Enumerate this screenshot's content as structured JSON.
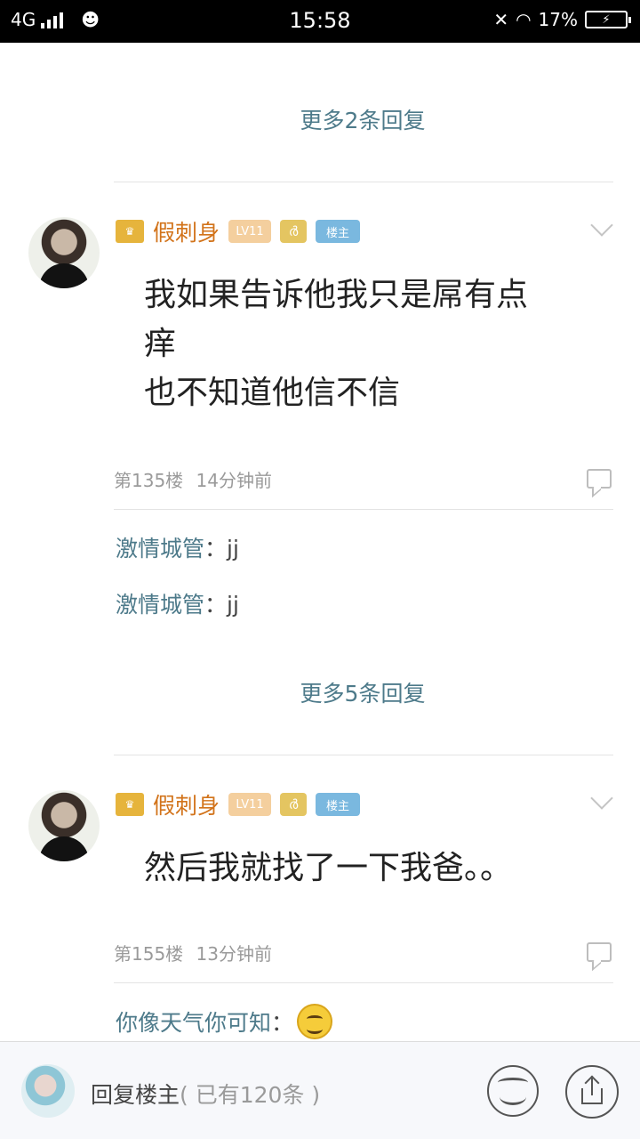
{
  "status_bar": {
    "network": "4G",
    "time": "15:58",
    "battery": "17%"
  },
  "thread": {
    "more_replies_top": "更多2条回复",
    "posts": [
      {
        "username": "假刺身",
        "level_badge": "LV11",
        "sign_badge": "ർ",
        "op_badge": "楼主",
        "text_lines": [
          "我如果告诉他我只是屌有点",
          "痒",
          "也不知道他信不信"
        ],
        "floor": "第135楼",
        "time_ago": "14分钟前",
        "replies": [
          {
            "user": "激情城管",
            "content": "：jj"
          },
          {
            "user": "激情城管",
            "content": "：jj"
          }
        ],
        "more_replies": "更多5条回复"
      },
      {
        "username": "假刺身",
        "level_badge": "LV11",
        "sign_badge": "ർ",
        "op_badge": "楼主",
        "text_lines": [
          "然后我就找了一下我爸。。"
        ],
        "floor": "第155楼",
        "time_ago": "13分钟前",
        "replies": [
          {
            "user": "你像天气你可知",
            "content": "："
          }
        ]
      }
    ]
  },
  "bottom_bar": {
    "reply_label": "回复楼主",
    "reply_count": "( 已有120条 )"
  },
  "icons": {
    "crown": "crown-icon",
    "chevron": "chevron-down-icon",
    "comment": "comment-icon",
    "emoji": "emoji-icon",
    "share": "share-icon",
    "smile": "smile-emoji-icon"
  }
}
